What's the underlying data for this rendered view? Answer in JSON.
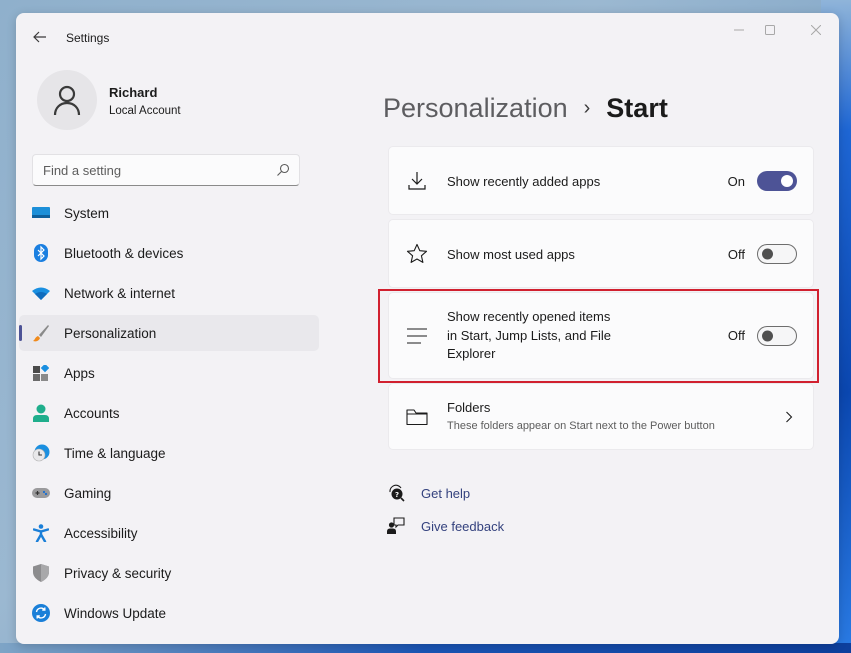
{
  "window": {
    "title": "Settings",
    "controls": {
      "minimize": "minimize-icon",
      "maximize": "maximize-icon",
      "close": "close-icon"
    }
  },
  "profile": {
    "name": "Richard",
    "account_type": "Local Account"
  },
  "search": {
    "placeholder": "Find a setting",
    "value": ""
  },
  "sidebar": {
    "active_index": 3,
    "items": [
      {
        "label": "System",
        "icon": "system-icon"
      },
      {
        "label": "Bluetooth & devices",
        "icon": "bluetooth-icon"
      },
      {
        "label": "Network & internet",
        "icon": "wifi-icon"
      },
      {
        "label": "Personalization",
        "icon": "paintbrush-icon"
      },
      {
        "label": "Apps",
        "icon": "apps-icon"
      },
      {
        "label": "Accounts",
        "icon": "accounts-icon"
      },
      {
        "label": "Time & language",
        "icon": "time-language-icon"
      },
      {
        "label": "Gaming",
        "icon": "gamepad-icon"
      },
      {
        "label": "Accessibility",
        "icon": "accessibility-icon"
      },
      {
        "label": "Privacy & security",
        "icon": "shield-icon"
      },
      {
        "label": "Windows Update",
        "icon": "update-icon"
      }
    ]
  },
  "breadcrumb": {
    "parent": "Personalization",
    "separator": "›",
    "current": "Start"
  },
  "settings": [
    {
      "label": "Show recently added apps",
      "icon": "download-icon",
      "state": "On",
      "enabled": true
    },
    {
      "label": "Show most used apps",
      "icon": "star-icon",
      "state": "Off",
      "enabled": false
    },
    {
      "label_lines": [
        "Show recently opened items",
        "in Start, Jump Lists, and File",
        "Explorer"
      ],
      "icon": "list-icon",
      "state": "Off",
      "enabled": false,
      "highlighted": true
    },
    {
      "label": "Folders",
      "description": "These folders appear on Start next to the Power button",
      "icon": "folder-icon"
    }
  ],
  "links": [
    {
      "label": "Get help",
      "icon": "help-icon"
    },
    {
      "label": "Give feedback",
      "icon": "feedback-icon"
    }
  ],
  "colors": {
    "accent": "#4d5396",
    "highlight_box": "#d1202f",
    "link": "#34427e"
  }
}
